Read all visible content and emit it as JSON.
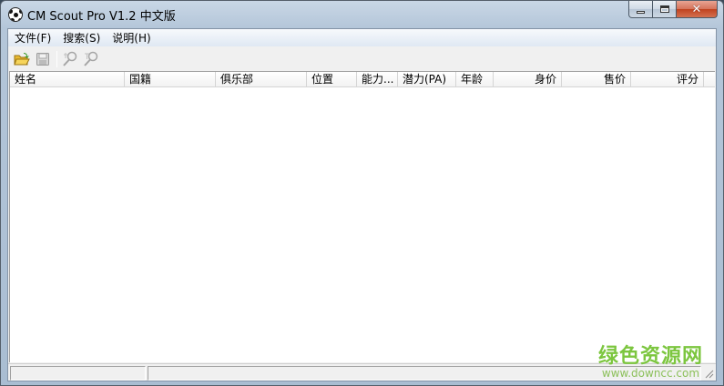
{
  "window": {
    "title": "CM Scout Pro V1.2 中文版",
    "icon": "soccer-ball-icon",
    "minimize_icon": "minimize-icon",
    "maximize_icon": "maximize-icon",
    "close_icon": "close-icon",
    "close_glyph": "✕"
  },
  "menu": {
    "items": [
      {
        "label": "文件(F)"
      },
      {
        "label": "搜索(S)"
      },
      {
        "label": "说明(H)"
      }
    ]
  },
  "toolbar": {
    "buttons": [
      {
        "icon": "open-folder-icon",
        "enabled": true
      },
      {
        "icon": "save-disk-icon",
        "enabled": false
      },
      {
        "icon": "search-icon",
        "enabled": false
      },
      {
        "icon": "search-next-icon",
        "enabled": false
      }
    ]
  },
  "table": {
    "columns": [
      {
        "label": "姓名"
      },
      {
        "label": "国籍"
      },
      {
        "label": "俱乐部"
      },
      {
        "label": "位置"
      },
      {
        "label": "能力..."
      },
      {
        "label": "潜力(PA)"
      },
      {
        "label": "年龄"
      },
      {
        "label": "身价"
      },
      {
        "label": "售价"
      },
      {
        "label": "评分"
      }
    ],
    "rows": []
  },
  "watermark": {
    "text": "绿色资源网",
    "url": "www.downcc.com"
  },
  "colors": {
    "accent_close": "#c0421f",
    "watermark_green": "#7cc63f",
    "folder_yellow": "#e8b830"
  }
}
